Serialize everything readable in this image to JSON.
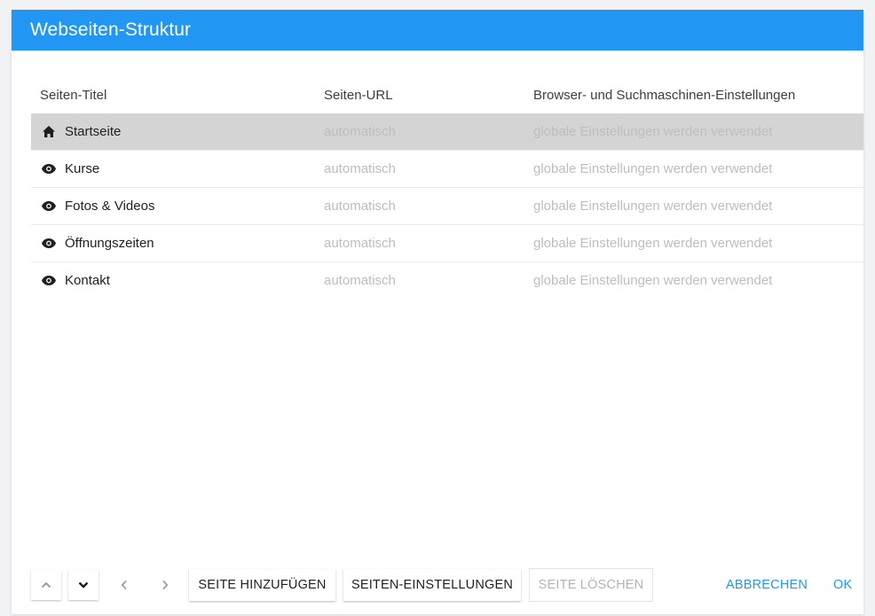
{
  "dialog": {
    "title": "Webseiten-Struktur"
  },
  "table": {
    "headers": {
      "title": "Seiten-Titel",
      "url": "Seiten-URL",
      "seo": "Browser- und Suchmaschinen-Einstellungen"
    },
    "rows": [
      {
        "icon": "home-icon",
        "title": "Startseite",
        "url": "automatisch",
        "seo": "globale Einstellungen werden verwendet",
        "selected": true
      },
      {
        "icon": "eye-icon",
        "title": "Kurse",
        "url": "automatisch",
        "seo": "globale Einstellungen werden verwendet",
        "selected": false
      },
      {
        "icon": "eye-icon",
        "title": "Fotos & Videos",
        "url": "automatisch",
        "seo": "globale Einstellungen werden verwendet",
        "selected": false
      },
      {
        "icon": "eye-icon",
        "title": "Öffnungszeiten",
        "url": "automatisch",
        "seo": "globale Einstellungen werden verwendet",
        "selected": false
      },
      {
        "icon": "eye-icon",
        "title": "Kontakt",
        "url": "automatisch",
        "seo": "globale Einstellungen werden verwendet",
        "selected": false
      }
    ]
  },
  "footer": {
    "up_icon": "chevron-up-icon",
    "down_icon": "chevron-down-icon",
    "left_icon": "chevron-left-icon",
    "right_icon": "chevron-right-icon",
    "add_page": "SEITE HINZUFÜGEN",
    "page_settings": "SEITEN-EINSTELLUNGEN",
    "delete_page": "SEITE LÖSCHEN",
    "cancel": "ABBRECHEN",
    "ok": "OK"
  },
  "colors": {
    "accent": "#2196f3",
    "selected_row": "#d4d4d4",
    "muted_text": "#bdbdbd"
  }
}
